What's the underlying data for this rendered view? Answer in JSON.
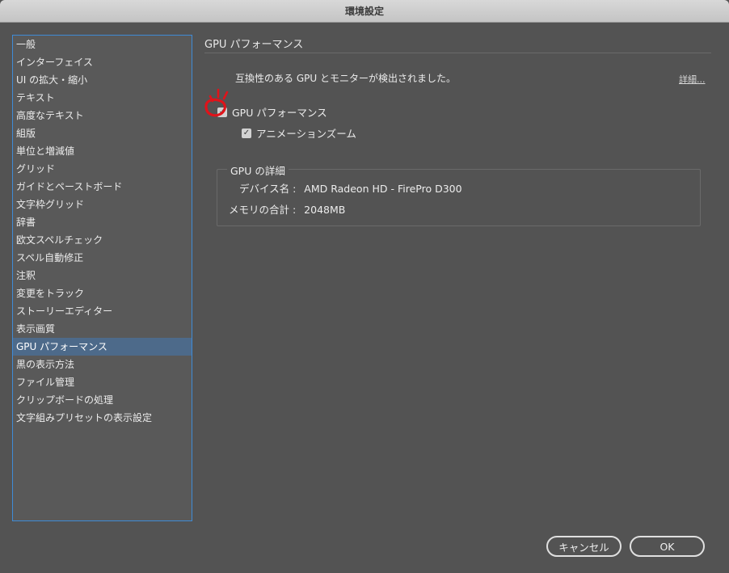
{
  "window": {
    "title": "環境設定"
  },
  "sidebar": {
    "items": [
      {
        "label": "一般"
      },
      {
        "label": "インターフェイス"
      },
      {
        "label": "UI の拡大・縮小"
      },
      {
        "label": "テキスト"
      },
      {
        "label": "高度なテキスト"
      },
      {
        "label": "組版"
      },
      {
        "label": "単位と増減値"
      },
      {
        "label": "グリッド"
      },
      {
        "label": "ガイドとペーストボード"
      },
      {
        "label": "文字枠グリッド"
      },
      {
        "label": "辞書"
      },
      {
        "label": "欧文スペルチェック"
      },
      {
        "label": "スペル自動修正"
      },
      {
        "label": "注釈"
      },
      {
        "label": "変更をトラック"
      },
      {
        "label": "ストーリーエディター"
      },
      {
        "label": "表示画質"
      },
      {
        "label": "GPU パフォーマンス"
      },
      {
        "label": "黒の表示方法"
      },
      {
        "label": "ファイル管理"
      },
      {
        "label": "クリップボードの処理"
      },
      {
        "label": "文字組みプリセットの表示設定"
      }
    ],
    "selected_index": 17
  },
  "main": {
    "section_title": "GPU パフォーマンス",
    "info_text": "互換性のある GPU とモニターが検出されました。",
    "details_link": "詳細...",
    "gpu_performance": {
      "label": "GPU パフォーマンス",
      "checked": true
    },
    "animation_zoom": {
      "label": "アニメーションズーム",
      "checked": true
    },
    "gpu_details": {
      "legend": "GPU の詳細",
      "device_name_label": "デバイス名 :",
      "device_name_value": "AMD Radeon HD - FirePro D300",
      "memory_label": "メモリの合計 :",
      "memory_value": "2048MB"
    }
  },
  "buttons": {
    "cancel": "キャンセル",
    "ok": "OK"
  },
  "colors": {
    "selection": "#4d6a8a",
    "focus_border": "#3f8bd6",
    "marker": "#e0131a",
    "background": "#535353"
  }
}
